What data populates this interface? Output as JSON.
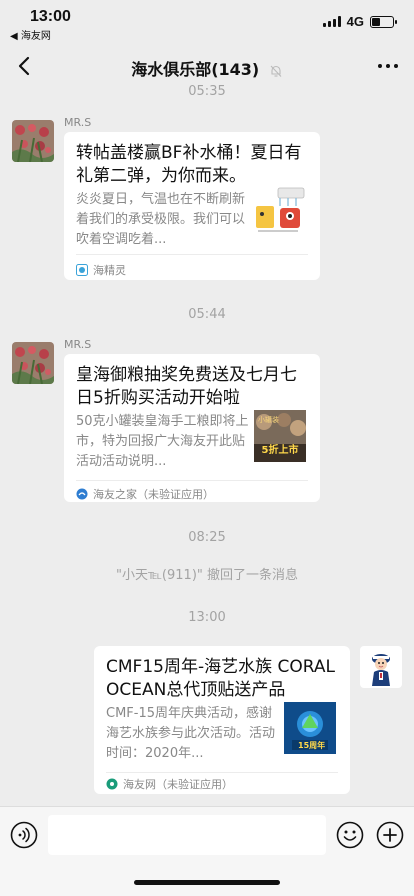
{
  "status_bar": {
    "time": "13:00",
    "back_app": "◀ 海友网",
    "network": "4G"
  },
  "nav": {
    "title": "海水俱乐部(143)",
    "back_icon": "chevron-left-icon",
    "mute_icon": "bell-muted-icon",
    "more_icon": "more-icon"
  },
  "chat": {
    "top_time": "05:35",
    "messages": [
      {
        "sender": "MR.S",
        "title": "转帖盖楼赢BF补水桶！夏日有礼第二弹，为你而来。",
        "desc": "炎炎夏日，气温也在不断刷新着我们的承受极限。我们可以吹着空调吃着...",
        "source": "海精灵"
      },
      {
        "time": "05:44",
        "sender": "MR.S",
        "title": "皇海御粮抽奖免费送及七月七日5折购买活动开始啦",
        "desc": "50克小罐装皇海手工粮即将上市，特为回报广大海友开此贴活动活动说明...",
        "thumb_text": "5折上市",
        "source": "海友之家（未验证应用）"
      },
      {
        "time": "08:25",
        "system": "\"小天℡(911)\" 撤回了一条消息"
      },
      {
        "time": "13:00",
        "title": "CMF15周年-海艺水族 CORAL OCEAN总代顶贴送产品",
        "desc": "CMF-15周年庆典活动，感谢海艺水族参与此次活动。活动时间：2020年...",
        "source": "海友网（未验证应用）"
      }
    ]
  },
  "input_bar": {
    "voice_icon": "voice-icon",
    "emoji_icon": "emoji-icon",
    "plus_icon": "plus-icon"
  }
}
